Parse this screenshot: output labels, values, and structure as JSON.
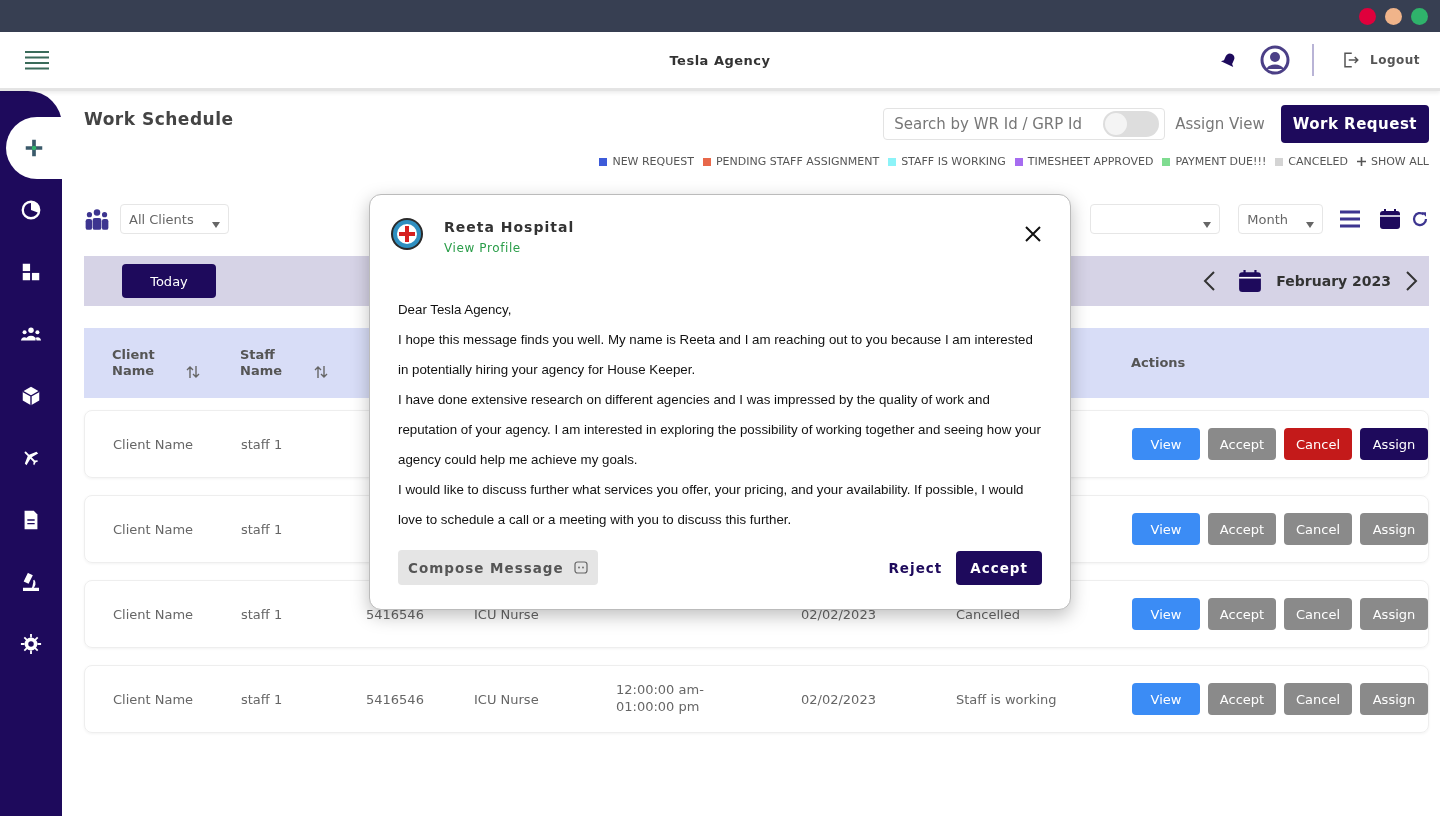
{
  "window": {
    "controls": [
      {
        "color": "#e0003c"
      },
      {
        "color": "#f0b48a"
      },
      {
        "color": "#2fb36b"
      }
    ]
  },
  "header": {
    "title": "Tesla Agency",
    "logout": "Logout"
  },
  "sidebar": {
    "items": [
      {
        "kind": "plus",
        "selected": true
      },
      {
        "kind": "pie",
        "selected": false
      },
      {
        "kind": "grid",
        "selected": false
      },
      {
        "kind": "team",
        "selected": false
      },
      {
        "kind": "box",
        "selected": false
      },
      {
        "kind": "plane",
        "selected": false
      },
      {
        "kind": "file",
        "selected": false
      },
      {
        "kind": "microscope",
        "selected": false
      },
      {
        "kind": "gear",
        "selected": false
      }
    ]
  },
  "page": {
    "title": "Work Schedule",
    "search": {
      "placeholder": "Search by WR Id / GRP Id"
    },
    "assign_view": {
      "label": "Assign View",
      "on": false
    },
    "work_request": "Work Request",
    "legend": [
      {
        "label": "NEW REQUEST",
        "color": "#3d5bd9"
      },
      {
        "label": "PENDING STAFF ASSIGNMENT",
        "color": "#e8684a"
      },
      {
        "label": "STAFF IS WORKING",
        "color": "#8cf3f8"
      },
      {
        "label": "TIMESHEET APPROVED",
        "color": "#a66cf0"
      },
      {
        "label": "PAYMENT DUE!!!",
        "color": "#7fdc90"
      },
      {
        "label": "CANCELED",
        "color": "#d4d4d4"
      },
      {
        "label": "SHOW ALL",
        "kind": "plus"
      }
    ],
    "filters": {
      "client": "All Clients",
      "period": "Month"
    },
    "calendar": {
      "today": "Today",
      "month": "February 2023"
    },
    "table": {
      "columns": [
        {
          "label": "Client Name",
          "sortable": true
        },
        {
          "label": "Staff Name",
          "sortable": true
        },
        {
          "label": "Actions",
          "sortable": false
        }
      ],
      "rows": [
        {
          "client": "Client Name",
          "staff": "staff 1",
          "actions": [
            {
              "label": "View",
              "kind": "view",
              "active": true
            },
            {
              "label": "Accept",
              "kind": "accept",
              "active": false
            },
            {
              "label": "Cancel",
              "kind": "cancel",
              "active": true
            },
            {
              "label": "Assign",
              "kind": "assign",
              "active": true
            }
          ]
        },
        {
          "client": "Client Name",
          "staff": "staff 1",
          "actions": [
            {
              "label": "View",
              "kind": "view",
              "active": true
            },
            {
              "label": "Accept",
              "kind": "accept",
              "active": false
            },
            {
              "label": "Cancel",
              "kind": "cancel",
              "active": false
            },
            {
              "label": "Assign",
              "kind": "assign",
              "active": false
            }
          ]
        },
        {
          "client": "Client Name",
          "staff": "staff 1",
          "wr_id": "5416546",
          "role": "ICU Nurse",
          "date": "02/02/2023",
          "status": "Cancelled",
          "actions": [
            {
              "label": "View",
              "kind": "view",
              "active": true
            },
            {
              "label": "Accept",
              "kind": "accept",
              "active": false
            },
            {
              "label": "Cancel",
              "kind": "cancel",
              "active": false
            },
            {
              "label": "Assign",
              "kind": "assign",
              "active": false
            }
          ]
        },
        {
          "client": "Client Name",
          "staff": "staff 1",
          "wr_id": "5416546",
          "role": "ICU Nurse",
          "time": "12:00:00 am-01:00:00 pm",
          "date": "02/02/2023",
          "status": "Staff is working",
          "actions": [
            {
              "label": "View",
              "kind": "view",
              "active": true
            },
            {
              "label": "Accept",
              "kind": "accept",
              "active": false
            },
            {
              "label": "Cancel",
              "kind": "cancel",
              "active": false
            },
            {
              "label": "Assign",
              "kind": "assign",
              "active": false
            }
          ]
        }
      ]
    }
  },
  "modal": {
    "sender": "Reeta Hospital",
    "profile_link": "View Profile",
    "greeting": "Dear Tesla Agency,",
    "paragraphs": [
      "I hope this message finds you well. My name is Reeta and I am reaching out to you because I am interested in potentially hiring your agency for House Keeper.",
      "I have done extensive research on different agencies and I was impressed by the quality of work and reputation of your agency. I am interested in exploring the possibility of working together and seeing how your agency could help me achieve my goals.",
      "I would like to discuss further what services you offer, your pricing, and your availability. If possible, I would love to schedule a call or a meeting with you to discuss this further."
    ],
    "compose": "Compose Message",
    "reject": "Reject",
    "accept": "Accept"
  }
}
